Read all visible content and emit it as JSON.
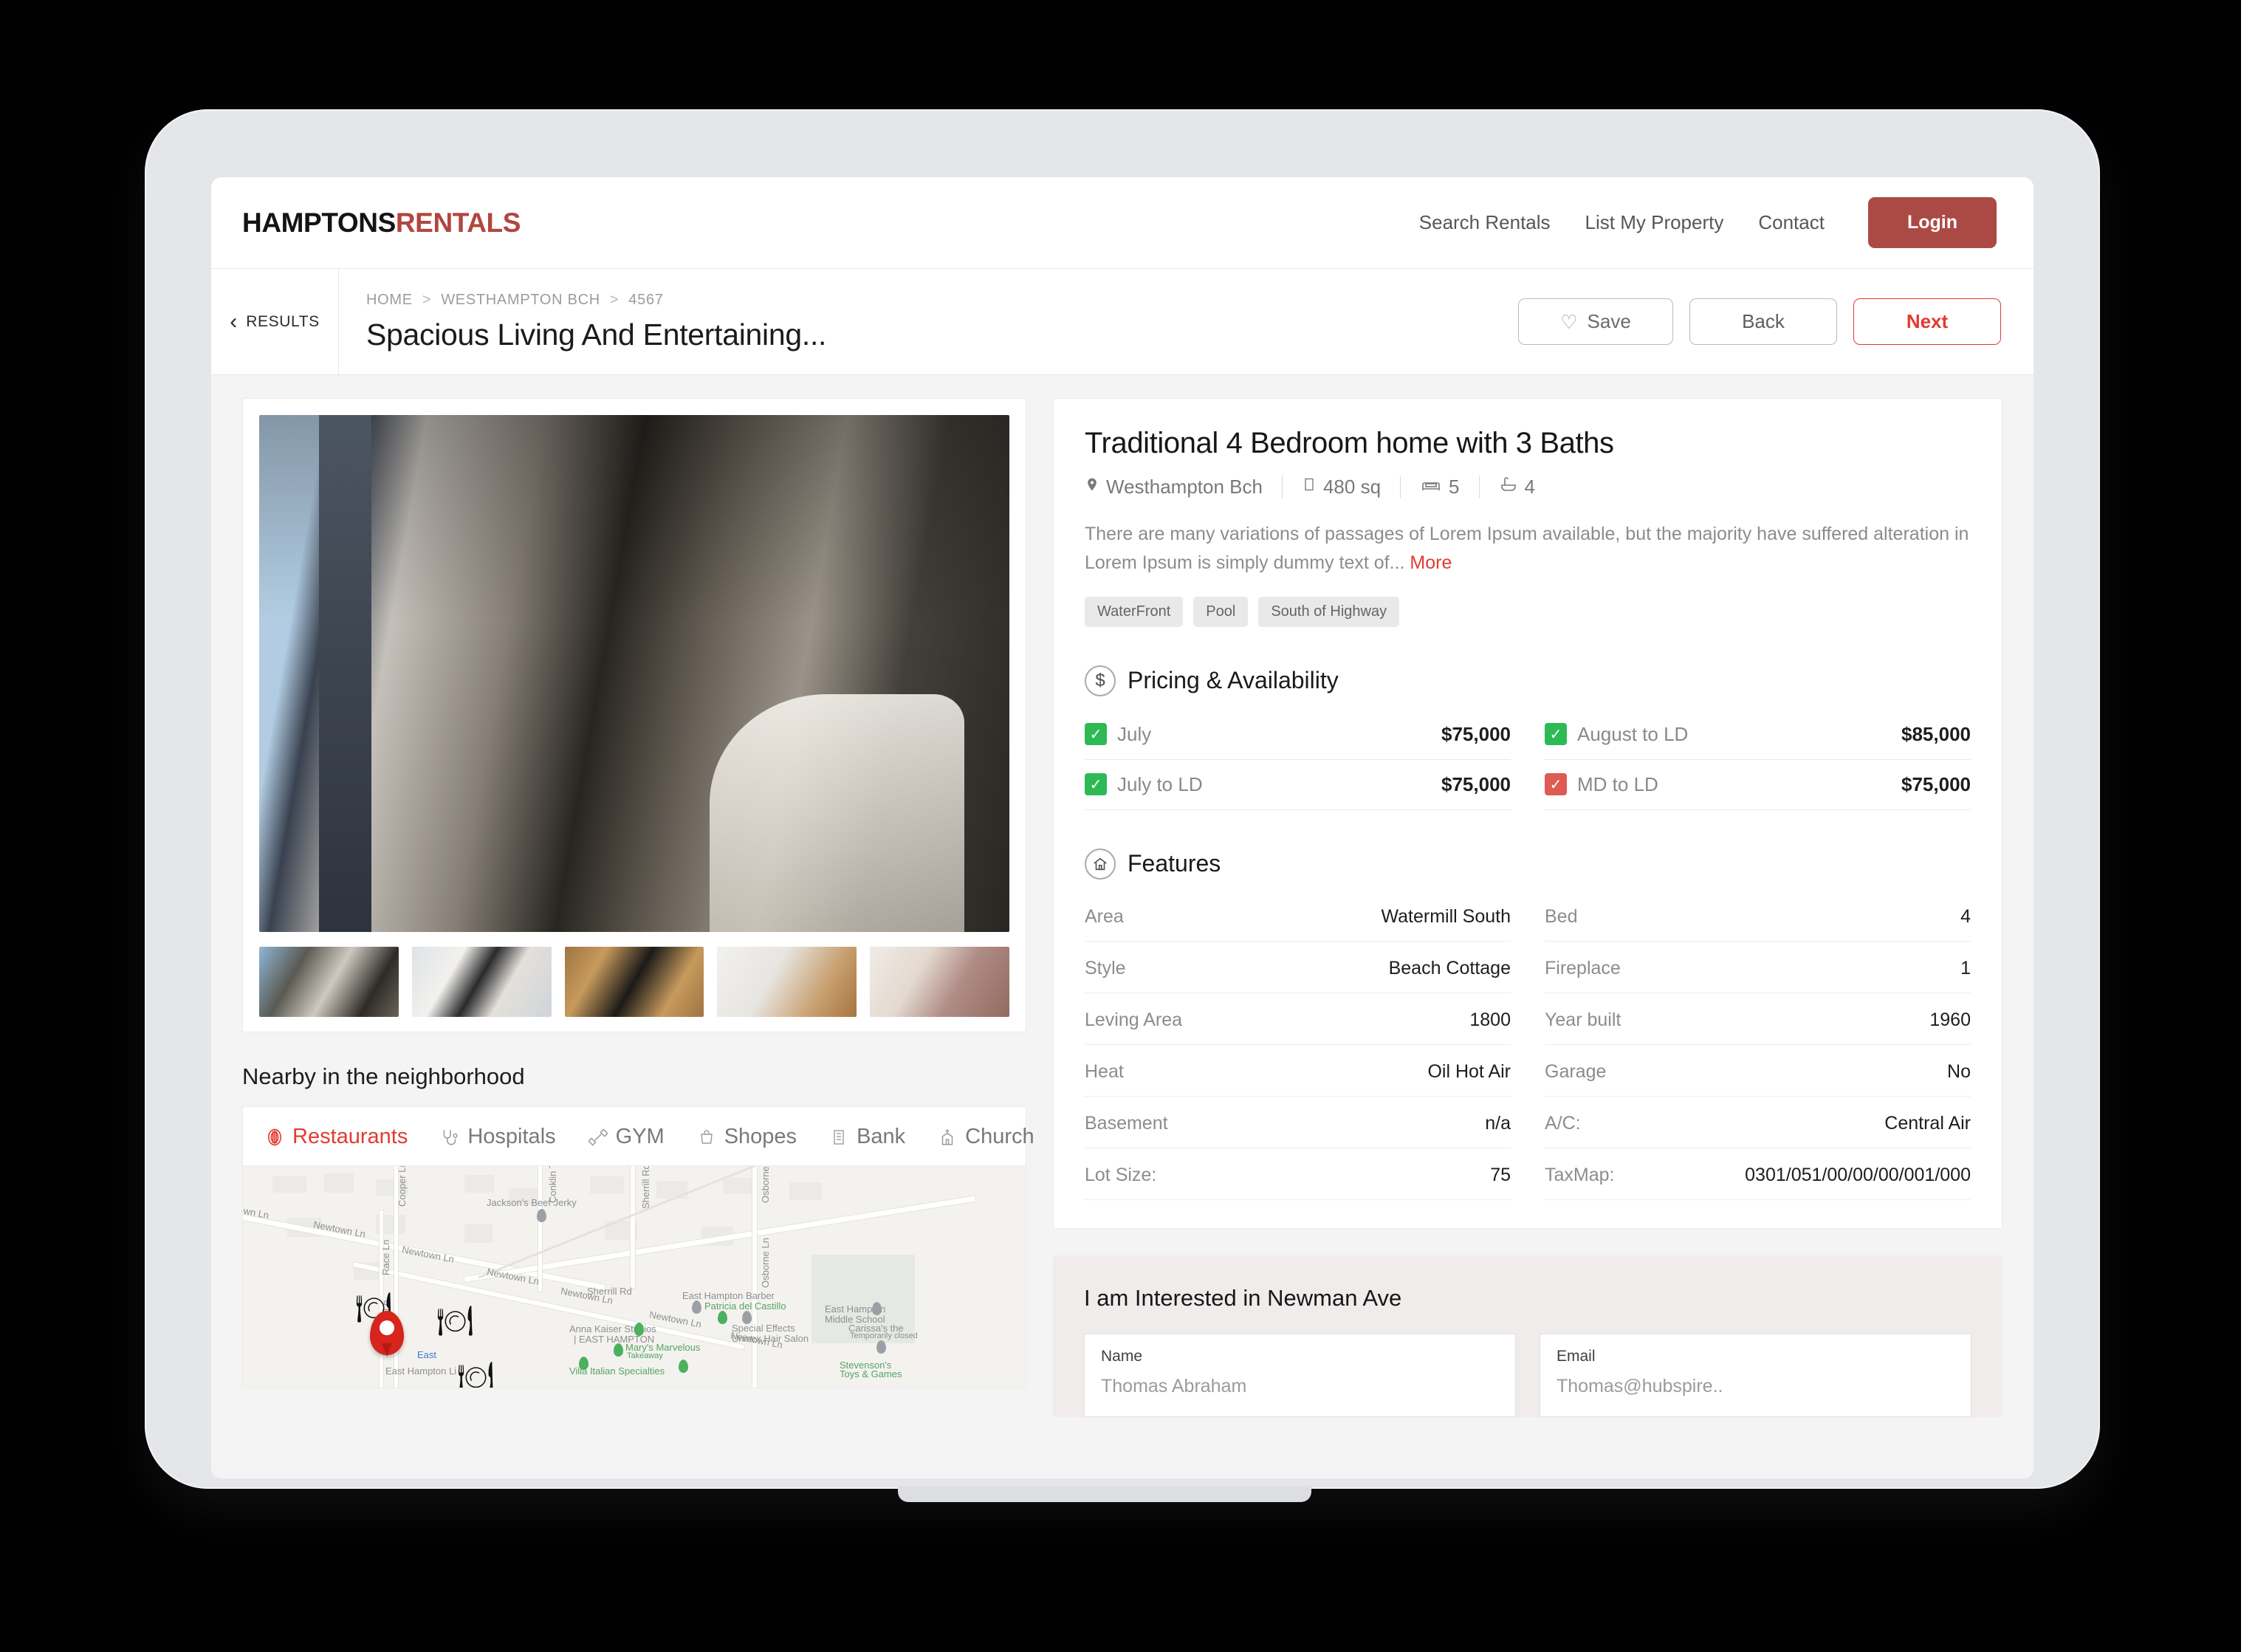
{
  "brand": {
    "part1": "HAMPTONS",
    "part2": "RENTALS"
  },
  "nav": {
    "links": [
      {
        "label": "Search Rentals"
      },
      {
        "label": "List My Property"
      },
      {
        "label": "Contact"
      }
    ],
    "login_label": "Login"
  },
  "subheader": {
    "results_label": "RESULTS",
    "breadcrumb": [
      "HOME",
      "WESTHAMPTON BCH",
      "4567"
    ],
    "separator": ">",
    "listing_title": "Spacious Living And Entertaining...",
    "actions": {
      "save_label": "Save",
      "back_label": "Back",
      "next_label": "Next"
    }
  },
  "gallery": {
    "thumb_count": 5
  },
  "neighborhood": {
    "title": "Nearby in the neighborhood",
    "tabs": [
      {
        "label": "Restaurants",
        "icon": "restaurant-icon",
        "active": true
      },
      {
        "label": "Hospitals",
        "icon": "stethoscope-icon",
        "active": false
      },
      {
        "label": "GYM",
        "icon": "dumbbell-icon",
        "active": false
      },
      {
        "label": "Shopes",
        "icon": "shopping-bag-icon",
        "active": false
      },
      {
        "label": "Bank",
        "icon": "bank-icon",
        "active": false
      },
      {
        "label": "Church",
        "icon": "church-icon",
        "active": false
      }
    ],
    "map": {
      "street_labels": [
        "Newtown Ln",
        "Newtown Ln",
        "Newtown Ln",
        "Newtown Ln",
        "Newtown Ln",
        "Cooper Ln",
        "Race Ln",
        "Race Ln",
        "Conklin Terrace",
        "Sherrill Rd",
        "Sherrill Rd",
        "Osborne Ln",
        "Osborne Ln"
      ],
      "places": [
        "Jackson's Beef Jerky",
        "East Hampton Barber",
        "Patricia del Castillo",
        "Special Effects",
        "Unisex Hair Salon",
        "East Hampton",
        "Middle School",
        "Anna Kaiser Studios",
        "| EAST HAMPTON",
        "Mary's Marvelous",
        "Takeaway",
        "Villa Italian Specialties",
        "East Hampton Li",
        "Carissa's the",
        "Temporarily closed",
        "Stevenson's",
        "Toys & Games"
      ]
    }
  },
  "property": {
    "title": "Traditional 4 Bedroom home with 3 Baths",
    "meta": [
      {
        "icon": "location-pin-icon",
        "value": "Westhampton Bch"
      },
      {
        "icon": "area-square-icon",
        "value": "480 sq"
      },
      {
        "icon": "bed-icon",
        "value": "5"
      },
      {
        "icon": "bathtub-icon",
        "value": "4"
      }
    ],
    "description": "There are many variations of passages of Lorem  Ipsum available, but the majority have suffered alteration in Lorem Ipsum is simply dummy text of...",
    "more_label": "More",
    "pills": [
      "WaterFront",
      "Pool",
      "South of Highway"
    ]
  },
  "pricing": {
    "section_title": "Pricing & Availability",
    "icon": "dollar-circle-icon",
    "rows": [
      {
        "label": "July",
        "value": "$75,000",
        "available": true
      },
      {
        "label": "August to LD",
        "value": "$85,000",
        "available": true
      },
      {
        "label": "July to LD",
        "value": "$75,000",
        "available": true
      },
      {
        "label": "MD to LD",
        "value": "$75,000",
        "available": false
      }
    ]
  },
  "features": {
    "section_title": "Features",
    "icon": "home-circle-icon",
    "left": [
      {
        "label": "Area",
        "value": "Watermill South"
      },
      {
        "label": "Style",
        "value": "Beach Cottage"
      },
      {
        "label": "Leving Area",
        "value": "1800"
      },
      {
        "label": "Heat",
        "value": "Oil Hot Air"
      },
      {
        "label": "Basement",
        "value": "n/a"
      },
      {
        "label": "Lot Size:",
        "value": "75"
      }
    ],
    "right": [
      {
        "label": "Bed",
        "value": "4"
      },
      {
        "label": "Fireplace",
        "value": "1"
      },
      {
        "label": "Year built",
        "value": "1960"
      },
      {
        "label": "Garage",
        "value": "No"
      },
      {
        "label": "A/C:",
        "value": "Central Air"
      },
      {
        "label": "TaxMap:",
        "value": "0301/051/00/00/00/001/000"
      }
    ]
  },
  "interest": {
    "title": "I am Interested in Newman Ave",
    "fields": [
      {
        "label": "Name",
        "value": "Thomas Abraham"
      },
      {
        "label": "Email",
        "value": "Thomas@hubspire.."
      }
    ]
  },
  "colors": {
    "brand_red": "#b2453f",
    "accent_red": "#e23b30",
    "login_bg": "#ab4a45",
    "available_green": "#2dba55",
    "unavailable_red": "#de5a52",
    "page_bg": "#f4f4f5",
    "interest_bg": "#efeceb"
  }
}
